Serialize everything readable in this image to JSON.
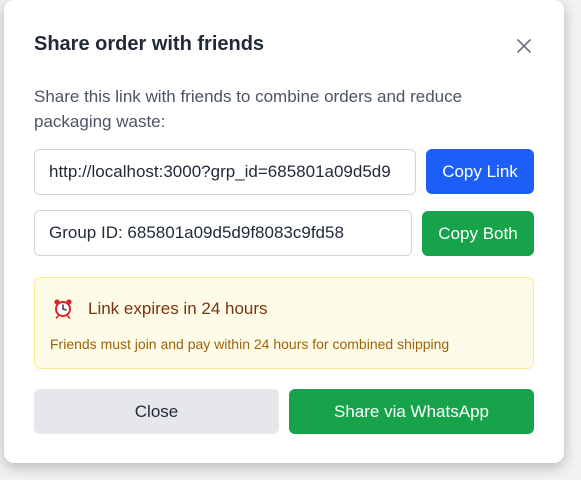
{
  "dialog": {
    "title": "Share order with friends",
    "description": "Share this link with friends to combine orders and reduce packaging waste:",
    "link_value": "http://localhost:3000?grp_id=685801a09d5d9",
    "copy_link_label": "Copy Link",
    "group_value": "Group ID: 685801a09d5d9f8083c9fd58",
    "copy_both_label": "Copy Both",
    "notice": {
      "icon": "alarm-clock-icon",
      "title": "Link expires in 24 hours",
      "subtitle": "Friends must join and pay within 24 hours for combined shipping"
    },
    "close_label": "Close",
    "whatsapp_label": "Share via WhatsApp"
  },
  "colors": {
    "primary_blue": "#1d5ef6",
    "green": "#16a34a",
    "notice_bg": "#fefce8",
    "notice_border": "#fde68a"
  }
}
